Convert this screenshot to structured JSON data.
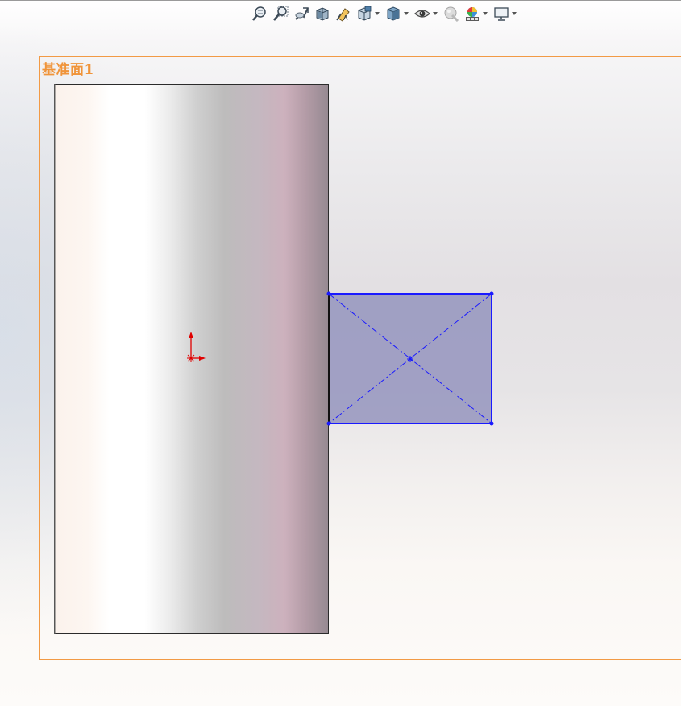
{
  "graphics_area": {
    "plane_label": "基准面1"
  },
  "heads_up_toolbar": {
    "items": [
      {
        "name": "zoom-to-fit",
        "icon": "zoom-fit-icon"
      },
      {
        "name": "zoom-to-area",
        "icon": "zoom-area-icon"
      },
      {
        "name": "previous-view",
        "icon": "previous-view-icon"
      },
      {
        "name": "section-view",
        "icon": "section-view-icon"
      },
      {
        "name": "dynamic-annotation-views",
        "icon": "annotation-view-icon"
      },
      {
        "name": "view-orientation",
        "icon": "view-orientation-icon",
        "dropdown": true
      },
      {
        "name": "display-style",
        "icon": "display-style-icon",
        "dropdown": true
      },
      {
        "name": "hide-show-items",
        "icon": "eye-icon",
        "dropdown": true
      },
      {
        "name": "edit-appearance",
        "icon": "appearance-icon"
      },
      {
        "name": "apply-scene",
        "icon": "scene-icon",
        "dropdown": true
      },
      {
        "name": "view-settings",
        "icon": "monitor-icon",
        "dropdown": true
      }
    ]
  },
  "colors": {
    "plane_border": "#f29a45",
    "plane_label": "#f0943a",
    "sketch_line": "#1a1aff",
    "sketch_fill": "#8a8ab8",
    "origin": "#e00000"
  }
}
